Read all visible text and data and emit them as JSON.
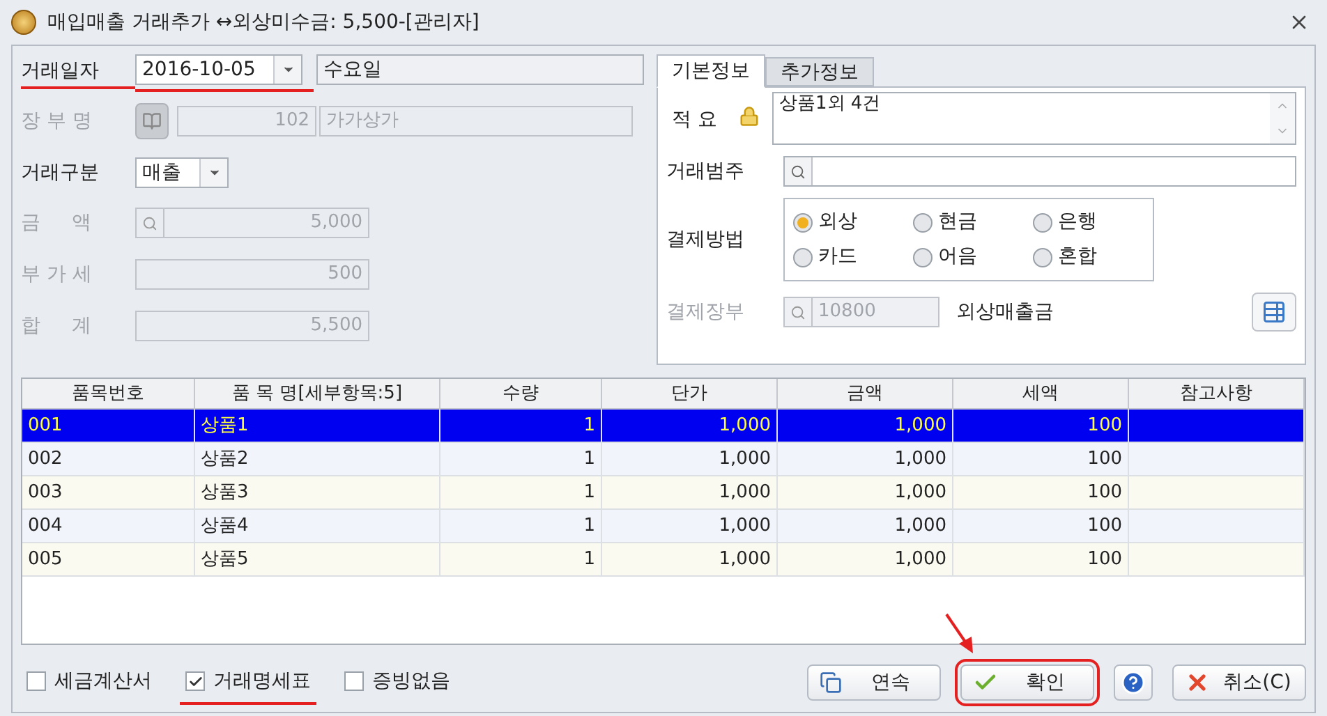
{
  "window": {
    "title": "매입매출 거래추가 ↔외상미수금: 5,500-[관리자]"
  },
  "form": {
    "date": {
      "label": "거래일자",
      "value": "2016-10-05",
      "weekday": "수요일",
      "annotated": true
    },
    "ledger": {
      "label": "장 부 명",
      "code": "102",
      "name": "가가상가",
      "disabled": true
    },
    "type": {
      "label": "거래구분",
      "value": "매출"
    },
    "amounts": [
      {
        "label": "금     액",
        "value": "5,000",
        "search": true
      },
      {
        "label": "부 가 세",
        "value": "500",
        "search": false
      },
      {
        "label": "합     계",
        "value": "5,500",
        "search": false
      }
    ]
  },
  "tabs": [
    {
      "label": "기본정보",
      "selected": true
    },
    {
      "label": "추가정보",
      "selected": false
    }
  ],
  "info": {
    "memo": {
      "label": "적 요",
      "value": "상품1외 4건"
    },
    "category": {
      "label": "거래범주"
    },
    "payment": {
      "label": "결제방법",
      "options": [
        {
          "label": "외상",
          "selected": true
        },
        {
          "label": "현금",
          "selected": false
        },
        {
          "label": "은행",
          "selected": false
        },
        {
          "label": "카드",
          "selected": false
        },
        {
          "label": "어음",
          "selected": false
        },
        {
          "label": "혼합",
          "selected": false
        }
      ]
    },
    "pay_ledger": {
      "label": "결제장부",
      "code": "10800",
      "name": "외상매출금"
    }
  },
  "table": {
    "columns": [
      "품목번호",
      "품 목 명[세부항목:5]",
      "수량",
      "단가",
      "금액",
      "세액",
      "참고사항"
    ],
    "rows": [
      {
        "cells": [
          "001",
          "상품1",
          "1",
          "1,000",
          "1,000",
          "100"
        ],
        "selected": true
      },
      {
        "cells": [
          "002",
          "상품2",
          "1",
          "1,000",
          "1,000",
          "100"
        ],
        "selected": false
      },
      {
        "cells": [
          "003",
          "상품3",
          "1",
          "1,000",
          "1,000",
          "100"
        ],
        "selected": false
      },
      {
        "cells": [
          "004",
          "상품4",
          "1",
          "1,000",
          "1,000",
          "100"
        ],
        "selected": false
      },
      {
        "cells": [
          "005",
          "상품5",
          "1",
          "1,000",
          "1,000",
          "100"
        ],
        "selected": false
      }
    ]
  },
  "options": [
    {
      "label": "세금계산서",
      "checked": false,
      "annotated": false
    },
    {
      "label": "거래명세표",
      "checked": true,
      "annotated": true
    },
    {
      "label": "증빙없음",
      "checked": false,
      "annotated": false
    }
  ],
  "buttons": [
    {
      "kind": "copy",
      "label": "연속",
      "annotated": false
    },
    {
      "kind": "ok",
      "label": "확인",
      "annotated": true
    },
    {
      "kind": "help",
      "annotated": false
    },
    {
      "kind": "cancel",
      "label": "취소(C)",
      "annotated": false
    }
  ]
}
